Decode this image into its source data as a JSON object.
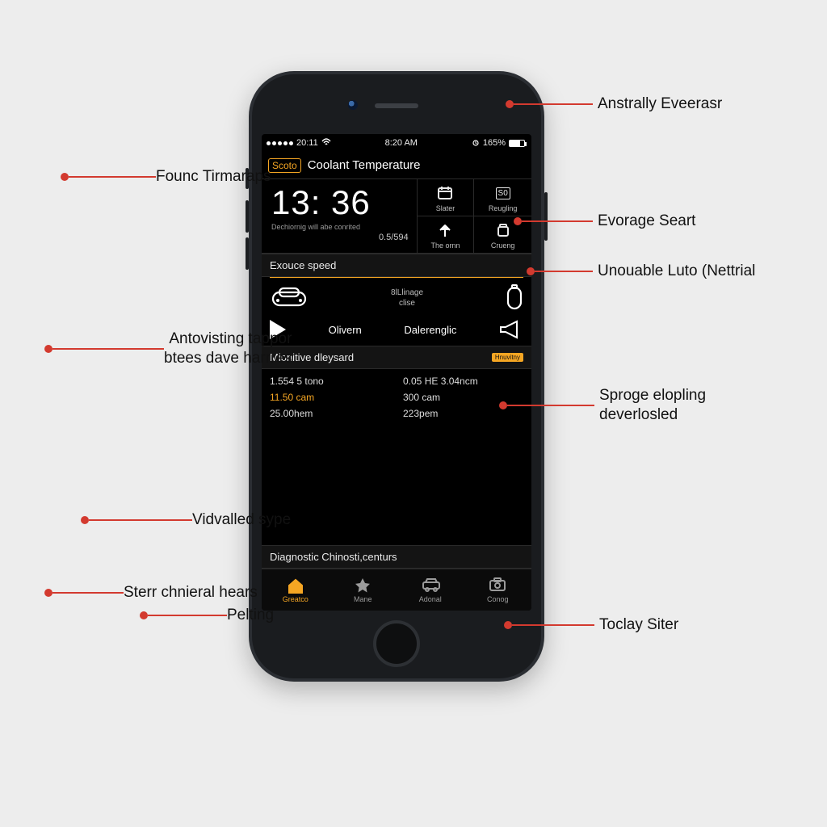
{
  "statusbar": {
    "time_left": "20:11",
    "time_center": "8:20 AM",
    "battery": "165%"
  },
  "header": {
    "back_label": "Scoto",
    "title": "Coolant Temperature"
  },
  "clock": {
    "big": "13: 36",
    "subtitle": "Dechiornig will abe conrited",
    "value": "0.5/594"
  },
  "tiles": [
    {
      "icon": "calendar-icon",
      "label": "Slater"
    },
    {
      "icon": "so-box-icon",
      "label": "Reugling",
      "badge": "S0"
    },
    {
      "icon": "arrow-up-icon",
      "label": "The ornn"
    },
    {
      "icon": "jar-icon",
      "label": "Crueng"
    }
  ],
  "sections": {
    "speed": {
      "title": "Exouce speed",
      "mid_top": "8lLlinage",
      "mid_bot": "clise",
      "left_word": "Olivern",
      "right_word": "Dalerenglic"
    },
    "monitive": {
      "title": "Mionitive dleysard",
      "badge": "Hnuvitny",
      "left": [
        "1.554 5 tono",
        "11.50 cam",
        "25.00hem"
      ],
      "right": [
        "0.05 HE 3.04ncm",
        "300 cam",
        "223pem"
      ]
    },
    "diag": {
      "title": "Diagnostic Chinosti,centurs"
    }
  },
  "tabs": [
    {
      "icon": "home-icon",
      "label": "Greatco",
      "active": true
    },
    {
      "icon": "star-icon",
      "label": "Mane",
      "active": false
    },
    {
      "icon": "car-icon",
      "label": "Adonal",
      "active": false
    },
    {
      "icon": "camera-icon",
      "label": "Conog",
      "active": false
    }
  ],
  "callouts": {
    "left": {
      "founc": "Founc Tirmaraps",
      "anto": "Antovisting tappor\nbtees dave harrres",
      "vidv": "Vidvalled sype",
      "sterr": "Sterr chnieral hears",
      "pelt": "Pelting"
    },
    "right": {
      "anstr": "Anstrally Eveerasr",
      "evor": "Evorage Seart",
      "unou": "Unouable Luto (Nettrial",
      "sproge": "Sproge elopling\ndeverlosled",
      "tocl": "Toclay Siter"
    }
  }
}
